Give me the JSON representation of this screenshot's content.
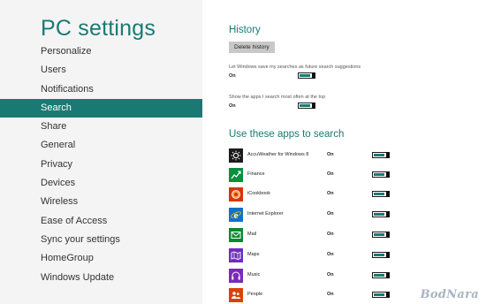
{
  "nav": {
    "title": "PC settings",
    "items": [
      {
        "label": "Personalize",
        "selected": false
      },
      {
        "label": "Users",
        "selected": false
      },
      {
        "label": "Notifications",
        "selected": false
      },
      {
        "label": "Search",
        "selected": true
      },
      {
        "label": "Share",
        "selected": false
      },
      {
        "label": "General",
        "selected": false
      },
      {
        "label": "Privacy",
        "selected": false
      },
      {
        "label": "Devices",
        "selected": false
      },
      {
        "label": "Wireless",
        "selected": false
      },
      {
        "label": "Ease of Access",
        "selected": false
      },
      {
        "label": "Sync your settings",
        "selected": false
      },
      {
        "label": "HomeGroup",
        "selected": false
      },
      {
        "label": "Windows Update",
        "selected": false
      }
    ]
  },
  "history": {
    "heading": "History",
    "delete_button": "Delete history",
    "setting1": {
      "label": "Let Windows save my searches as future search suggestions",
      "state": "On"
    },
    "setting2": {
      "label": "Show the apps I search most often at the top",
      "state": "On"
    }
  },
  "apps": {
    "heading": "Use these apps to search",
    "items": [
      {
        "name": "AccuWeather for Windows 8",
        "state": "On",
        "icon": "sun-icon",
        "color": "#1b1b1b"
      },
      {
        "name": "Finance",
        "state": "On",
        "icon": "chart-up-icon",
        "color": "#0a8f3c"
      },
      {
        "name": "iCookbook",
        "state": "On",
        "icon": "cookbook-icon",
        "color": "#d8350c"
      },
      {
        "name": "Internet Explorer",
        "state": "On",
        "icon": "ie-icon",
        "color": "#1470c8"
      },
      {
        "name": "Mail",
        "state": "On",
        "icon": "mail-icon",
        "color": "#0b8a30"
      },
      {
        "name": "Maps",
        "state": "On",
        "icon": "map-icon",
        "color": "#6b2fc0"
      },
      {
        "name": "Music",
        "state": "On",
        "icon": "headphones-icon",
        "color": "#7a2ab8"
      },
      {
        "name": "People",
        "state": "On",
        "icon": "people-icon",
        "color": "#d8420c"
      }
    ]
  },
  "watermark": "BodNara"
}
